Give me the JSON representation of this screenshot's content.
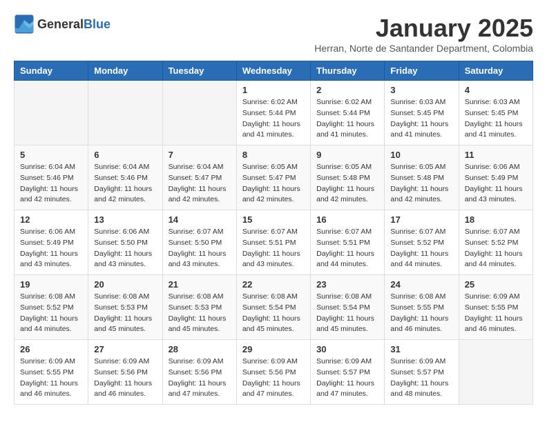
{
  "header": {
    "logo_general": "General",
    "logo_blue": "Blue",
    "month_year": "January 2025",
    "location": "Herran, Norte de Santander Department, Colombia"
  },
  "days_of_week": [
    "Sunday",
    "Monday",
    "Tuesday",
    "Wednesday",
    "Thursday",
    "Friday",
    "Saturday"
  ],
  "weeks": [
    [
      {
        "day": "",
        "info": ""
      },
      {
        "day": "",
        "info": ""
      },
      {
        "day": "",
        "info": ""
      },
      {
        "day": "1",
        "info": "Sunrise: 6:02 AM\nSunset: 5:44 PM\nDaylight: 11 hours\nand 41 minutes."
      },
      {
        "day": "2",
        "info": "Sunrise: 6:02 AM\nSunset: 5:44 PM\nDaylight: 11 hours\nand 41 minutes."
      },
      {
        "day": "3",
        "info": "Sunrise: 6:03 AM\nSunset: 5:45 PM\nDaylight: 11 hours\nand 41 minutes."
      },
      {
        "day": "4",
        "info": "Sunrise: 6:03 AM\nSunset: 5:45 PM\nDaylight: 11 hours\nand 41 minutes."
      }
    ],
    [
      {
        "day": "5",
        "info": "Sunrise: 6:04 AM\nSunset: 5:46 PM\nDaylight: 11 hours\nand 42 minutes."
      },
      {
        "day": "6",
        "info": "Sunrise: 6:04 AM\nSunset: 5:46 PM\nDaylight: 11 hours\nand 42 minutes."
      },
      {
        "day": "7",
        "info": "Sunrise: 6:04 AM\nSunset: 5:47 PM\nDaylight: 11 hours\nand 42 minutes."
      },
      {
        "day": "8",
        "info": "Sunrise: 6:05 AM\nSunset: 5:47 PM\nDaylight: 11 hours\nand 42 minutes."
      },
      {
        "day": "9",
        "info": "Sunrise: 6:05 AM\nSunset: 5:48 PM\nDaylight: 11 hours\nand 42 minutes."
      },
      {
        "day": "10",
        "info": "Sunrise: 6:05 AM\nSunset: 5:48 PM\nDaylight: 11 hours\nand 42 minutes."
      },
      {
        "day": "11",
        "info": "Sunrise: 6:06 AM\nSunset: 5:49 PM\nDaylight: 11 hours\nand 43 minutes."
      }
    ],
    [
      {
        "day": "12",
        "info": "Sunrise: 6:06 AM\nSunset: 5:49 PM\nDaylight: 11 hours\nand 43 minutes."
      },
      {
        "day": "13",
        "info": "Sunrise: 6:06 AM\nSunset: 5:50 PM\nDaylight: 11 hours\nand 43 minutes."
      },
      {
        "day": "14",
        "info": "Sunrise: 6:07 AM\nSunset: 5:50 PM\nDaylight: 11 hours\nand 43 minutes."
      },
      {
        "day": "15",
        "info": "Sunrise: 6:07 AM\nSunset: 5:51 PM\nDaylight: 11 hours\nand 43 minutes."
      },
      {
        "day": "16",
        "info": "Sunrise: 6:07 AM\nSunset: 5:51 PM\nDaylight: 11 hours\nand 44 minutes."
      },
      {
        "day": "17",
        "info": "Sunrise: 6:07 AM\nSunset: 5:52 PM\nDaylight: 11 hours\nand 44 minutes."
      },
      {
        "day": "18",
        "info": "Sunrise: 6:07 AM\nSunset: 5:52 PM\nDaylight: 11 hours\nand 44 minutes."
      }
    ],
    [
      {
        "day": "19",
        "info": "Sunrise: 6:08 AM\nSunset: 5:52 PM\nDaylight: 11 hours\nand 44 minutes."
      },
      {
        "day": "20",
        "info": "Sunrise: 6:08 AM\nSunset: 5:53 PM\nDaylight: 11 hours\nand 45 minutes."
      },
      {
        "day": "21",
        "info": "Sunrise: 6:08 AM\nSunset: 5:53 PM\nDaylight: 11 hours\nand 45 minutes."
      },
      {
        "day": "22",
        "info": "Sunrise: 6:08 AM\nSunset: 5:54 PM\nDaylight: 11 hours\nand 45 minutes."
      },
      {
        "day": "23",
        "info": "Sunrise: 6:08 AM\nSunset: 5:54 PM\nDaylight: 11 hours\nand 45 minutes."
      },
      {
        "day": "24",
        "info": "Sunrise: 6:08 AM\nSunset: 5:55 PM\nDaylight: 11 hours\nand 46 minutes."
      },
      {
        "day": "25",
        "info": "Sunrise: 6:09 AM\nSunset: 5:55 PM\nDaylight: 11 hours\nand 46 minutes."
      }
    ],
    [
      {
        "day": "26",
        "info": "Sunrise: 6:09 AM\nSunset: 5:55 PM\nDaylight: 11 hours\nand 46 minutes."
      },
      {
        "day": "27",
        "info": "Sunrise: 6:09 AM\nSunset: 5:56 PM\nDaylight: 11 hours\nand 46 minutes."
      },
      {
        "day": "28",
        "info": "Sunrise: 6:09 AM\nSunset: 5:56 PM\nDaylight: 11 hours\nand 47 minutes."
      },
      {
        "day": "29",
        "info": "Sunrise: 6:09 AM\nSunset: 5:56 PM\nDaylight: 11 hours\nand 47 minutes."
      },
      {
        "day": "30",
        "info": "Sunrise: 6:09 AM\nSunset: 5:57 PM\nDaylight: 11 hours\nand 47 minutes."
      },
      {
        "day": "31",
        "info": "Sunrise: 6:09 AM\nSunset: 5:57 PM\nDaylight: 11 hours\nand 48 minutes."
      },
      {
        "day": "",
        "info": ""
      }
    ]
  ]
}
